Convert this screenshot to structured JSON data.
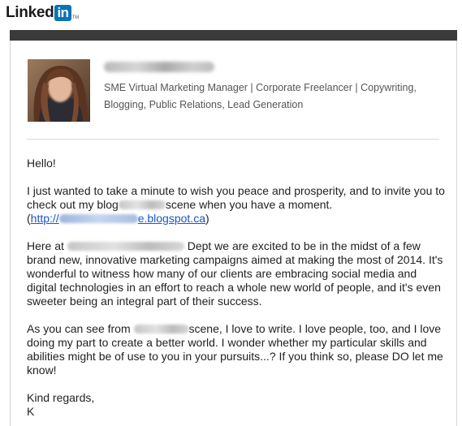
{
  "brand": {
    "name": "Linked",
    "box": "in",
    "tm": "TM"
  },
  "sender": {
    "headline": "SME Virtual Marketing Manager | Corporate Freelancer | Copywriting, Blogging, Public Relations, Lead Generation"
  },
  "message": {
    "greeting": "Hello!",
    "p1_a": "I just wanted to take a minute to wish you peace and prosperity, and to invite you to check out my blog",
    "p1_b": "scene when you have a moment.",
    "p1_open": "(",
    "link_a": "http://",
    "link_b": "e.blogspot.ca",
    "p1_close": ")",
    "p2_a": "Here at",
    "p2_b": "Dept we are excited to be in the midst of a few brand new, innovative marketing campaigns aimed at making the most of 2014. It's wonderful to witness how many of our clients are embracing social media and digital technologies in an effort to reach a whole new world of people, and it's even sweeter being an integral part of their success.",
    "p3_a": "As you can see from",
    "p3_b": "scene, I love to write. I love people, too, and I love doing my part to create a better world. I wonder whether my particular skills and abilities might be of use to you in your pursuits...? If you think so, please DO let me know!",
    "closing": "Kind regards,",
    "signature_initial": "K"
  }
}
